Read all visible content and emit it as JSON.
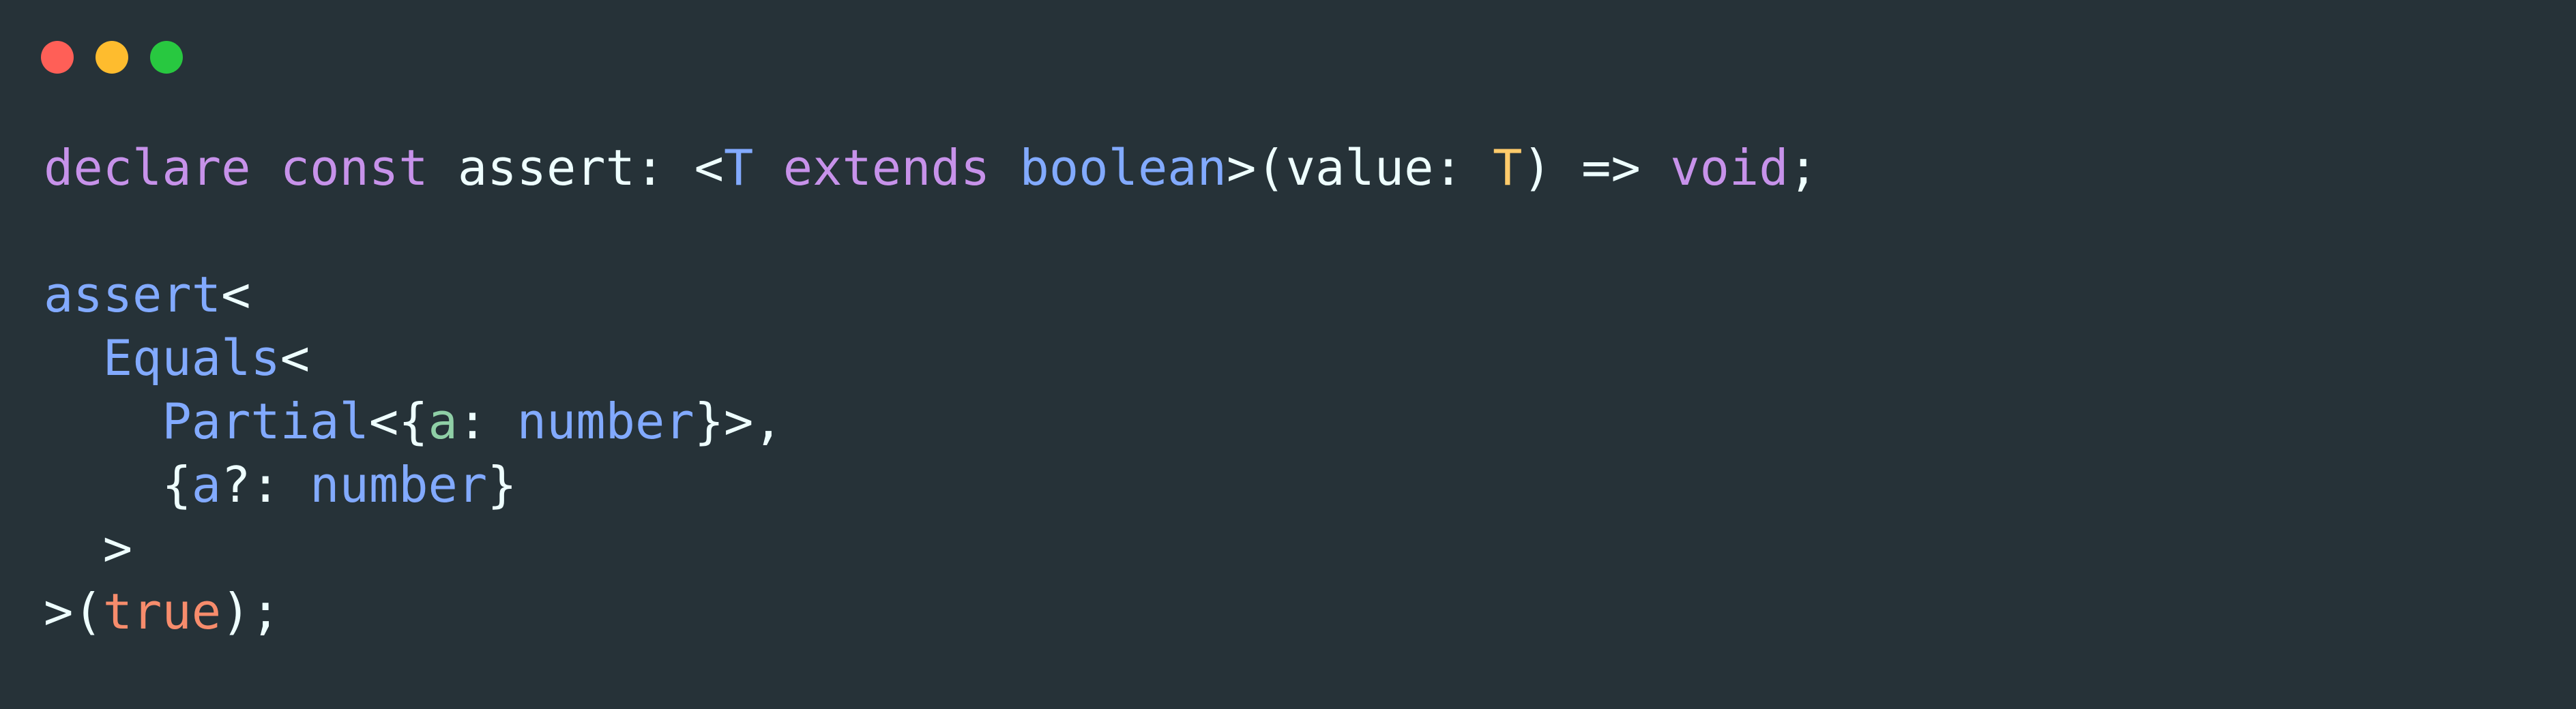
{
  "window": {
    "buttons": [
      {
        "name": "close",
        "color": "#ff5f57"
      },
      {
        "name": "minimize",
        "color": "#febc2e"
      },
      {
        "name": "maximize",
        "color": "#28c840"
      }
    ]
  },
  "colors": {
    "background": "#263238",
    "plain": "#eeffff",
    "keyword": "#c792ea",
    "type": "#82aaff",
    "function": "#82aaff",
    "typeParam": "#ffcb6b",
    "property": "#82aaff",
    "propertyGreen": "#8fcfa6",
    "literal": "#f78c6c"
  },
  "code": {
    "lines": [
      {
        "tokens": [
          {
            "text": "declare",
            "kind": "keyword"
          },
          {
            "text": " ",
            "kind": "plain"
          },
          {
            "text": "const",
            "kind": "keyword"
          },
          {
            "text": " assert: <",
            "kind": "plain"
          },
          {
            "text": "T",
            "kind": "type"
          },
          {
            "text": " ",
            "kind": "plain"
          },
          {
            "text": "extends",
            "kind": "keyword"
          },
          {
            "text": " ",
            "kind": "plain"
          },
          {
            "text": "boolean",
            "kind": "type"
          },
          {
            "text": ">(value: ",
            "kind": "plain"
          },
          {
            "text": "T",
            "kind": "typeParam"
          },
          {
            "text": ") => ",
            "kind": "plain"
          },
          {
            "text": "void",
            "kind": "keyword"
          },
          {
            "text": ";",
            "kind": "plain"
          }
        ]
      },
      {
        "tokens": []
      },
      {
        "tokens": [
          {
            "text": "assert",
            "kind": "function"
          },
          {
            "text": "<",
            "kind": "plain"
          }
        ]
      },
      {
        "tokens": [
          {
            "text": "  ",
            "kind": "plain"
          },
          {
            "text": "Equals",
            "kind": "type"
          },
          {
            "text": "<",
            "kind": "plain"
          }
        ]
      },
      {
        "tokens": [
          {
            "text": "    ",
            "kind": "plain"
          },
          {
            "text": "Partial",
            "kind": "type"
          },
          {
            "text": "<{",
            "kind": "plain"
          },
          {
            "text": "a",
            "kind": "propertyGreen"
          },
          {
            "text": ": ",
            "kind": "plain"
          },
          {
            "text": "number",
            "kind": "type"
          },
          {
            "text": "}>,",
            "kind": "plain"
          }
        ]
      },
      {
        "tokens": [
          {
            "text": "    {",
            "kind": "plain"
          },
          {
            "text": "a",
            "kind": "property"
          },
          {
            "text": "?: ",
            "kind": "plain"
          },
          {
            "text": "number",
            "kind": "type"
          },
          {
            "text": "}",
            "kind": "plain"
          }
        ]
      },
      {
        "tokens": [
          {
            "text": "  >",
            "kind": "plain"
          }
        ]
      },
      {
        "tokens": [
          {
            "text": ">(",
            "kind": "plain"
          },
          {
            "text": "true",
            "kind": "literal"
          },
          {
            "text": ");",
            "kind": "plain"
          }
        ]
      }
    ]
  }
}
